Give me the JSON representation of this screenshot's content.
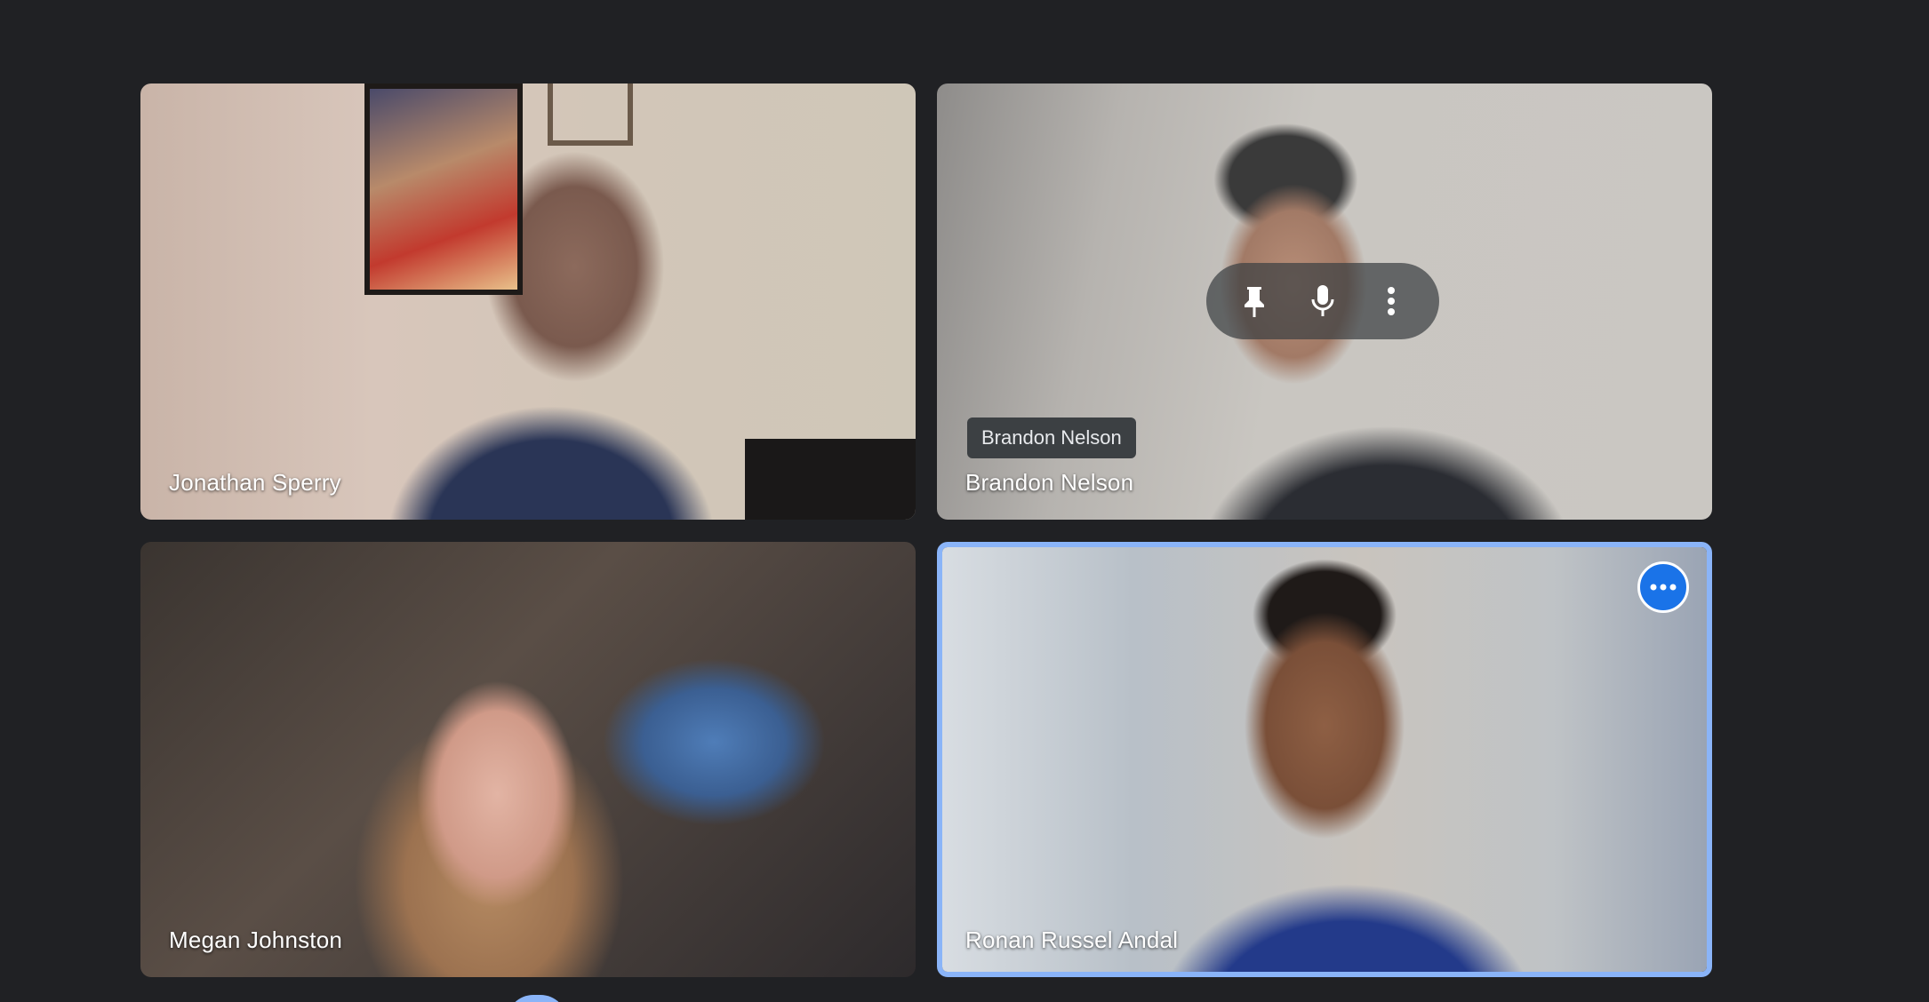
{
  "participants": [
    {
      "name": "Jonathan Sperry"
    },
    {
      "name": "Brandon Nelson"
    },
    {
      "name": "Megan Johnston"
    },
    {
      "name": "Ronan Russel Andal"
    }
  ],
  "tooltip": {
    "text": "Brandon Nelson"
  },
  "hover_controls": {
    "icons": [
      "pin-icon",
      "microphone-icon",
      "more-vert-icon"
    ]
  },
  "active_tile": {
    "highlight_color": "#8ab4f8",
    "more_button_color": "#1a73e8",
    "more_button_icon": "more-horiz-icon"
  },
  "colors": {
    "background": "#202124",
    "accent": "#8ab4f8"
  }
}
